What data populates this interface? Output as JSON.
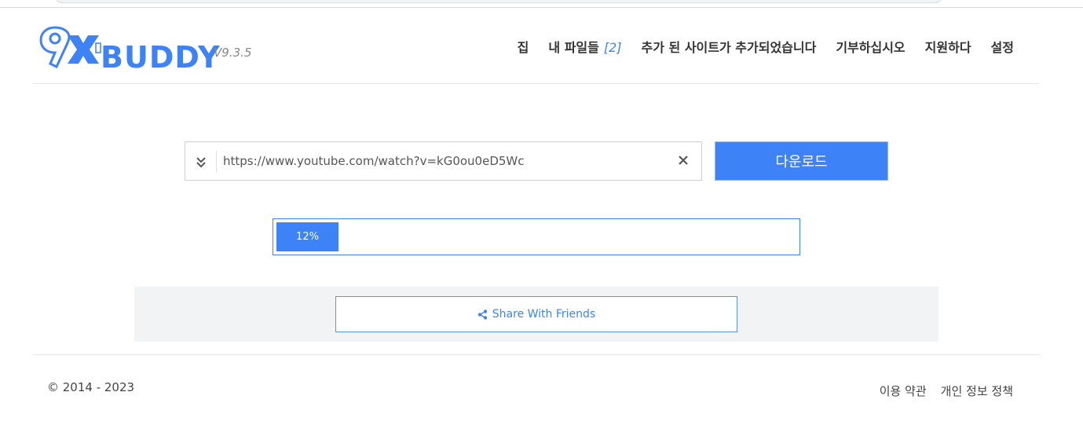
{
  "brand": {
    "logo_text": "BUDDY",
    "version": "V9.3.5",
    "accent_color": "#3e82f7"
  },
  "nav": {
    "items": [
      {
        "label": "집"
      },
      {
        "label": "내 파일들",
        "count": "[2]"
      },
      {
        "label": "추가 된 사이트가 추가되었습니다"
      },
      {
        "label": "기부하십시오"
      },
      {
        "label": "지원하다"
      },
      {
        "label": "설정"
      }
    ]
  },
  "search": {
    "value": "https://www.youtube.com/watch?v=kG0ou0eD5Wc",
    "download_label": "다운로드",
    "icons": {
      "expand": "double-chevron-down-icon",
      "clear": "close-icon"
    }
  },
  "progress": {
    "percent": 12,
    "label": "12%"
  },
  "share": {
    "label": "Share With Friends",
    "icon": "share-icon"
  },
  "footer": {
    "copyright": "© 2014 - 2023",
    "links": [
      "이용 약관",
      "개인 정보 정책"
    ]
  }
}
